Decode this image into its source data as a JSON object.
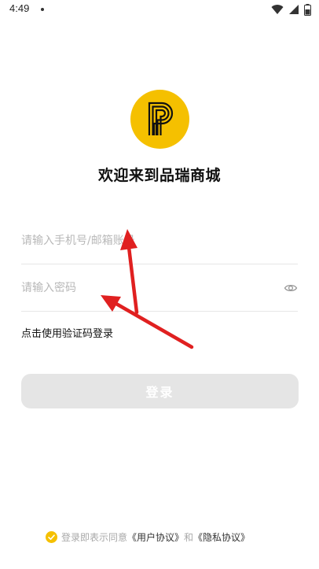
{
  "status_bar": {
    "time": "4:49",
    "icons": [
      "wifi-icon",
      "signal-icon",
      "battery-icon"
    ]
  },
  "brand": {
    "logo_icon": "p-logo-icon",
    "accent_color": "#F5C000"
  },
  "welcome_title": "欢迎来到品瑞商城",
  "account_field": {
    "placeholder": "请输入手机号/邮箱账号",
    "value": ""
  },
  "password_field": {
    "placeholder": "请输入密码",
    "value": "",
    "toggle_icon": "eye-icon"
  },
  "sms_login_link": "点击使用验证码登录",
  "login_button": "登录",
  "agreement": {
    "checked": true,
    "prefix": "登录即表示同意",
    "user_agreement": "《用户协议》",
    "and": "和",
    "privacy_policy": "《隐私协议》"
  }
}
